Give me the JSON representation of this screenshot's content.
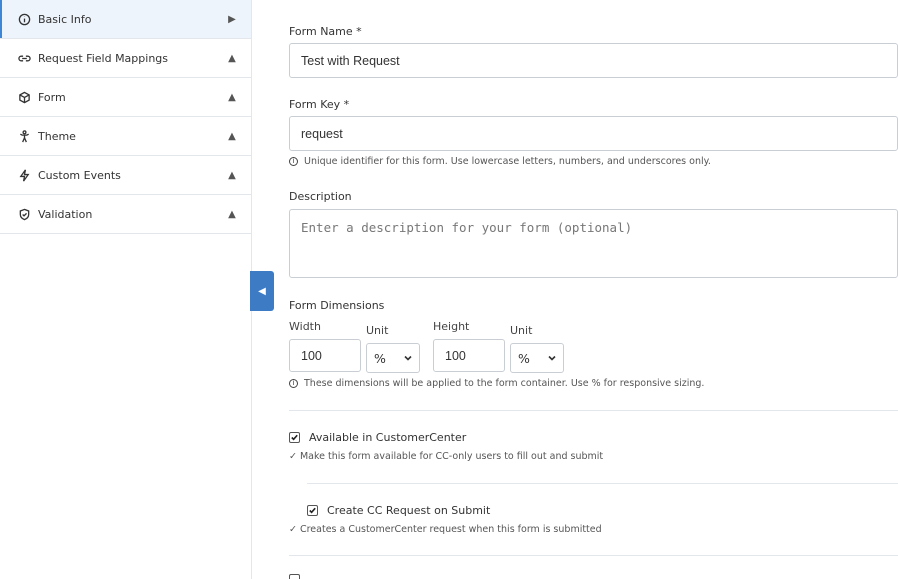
{
  "sidebar": {
    "items": [
      {
        "label": "Basic Info",
        "icon": "info-icon",
        "arrow": "▶"
      },
      {
        "label": "Request Field Mappings",
        "icon": "link-icon",
        "arrow": "▲"
      },
      {
        "label": "Form",
        "icon": "cube-icon",
        "arrow": "▲"
      },
      {
        "label": "Theme",
        "icon": "person-icon",
        "arrow": "▲"
      },
      {
        "label": "Custom Events",
        "icon": "lightning-icon",
        "arrow": "▲"
      },
      {
        "label": "Validation",
        "icon": "shield-check-icon",
        "arrow": "▲"
      }
    ],
    "collapse_glyph": "◀"
  },
  "form": {
    "name_label": "Form Name *",
    "name_value": "Test with Request",
    "key_label": "Form Key *",
    "key_value": "request",
    "key_hint": "Unique identifier for this form. Use lowercase letters, numbers, and underscores only.",
    "description_label": "Description",
    "description_placeholder": "Enter a description for your form (optional)",
    "dimensions_label": "Form Dimensions",
    "width_label": "Width",
    "width_value": "100",
    "width_unit_label": "Unit",
    "width_unit_value": "%",
    "height_label": "Height",
    "height_value": "100",
    "height_unit_label": "Unit",
    "height_unit_value": "%",
    "dimensions_hint": "These dimensions will be applied to the form container. Use % for responsive sizing.",
    "info_glyph": "i",
    "available_cc_label": "Available in CustomerCenter",
    "available_cc_hint": "✓ Make this form available for CC-only users to fill out and submit",
    "create_cc_label": "Create CC Request on Submit",
    "create_cc_hint": "✓ Creates a CustomerCenter request when this form is submitted"
  }
}
